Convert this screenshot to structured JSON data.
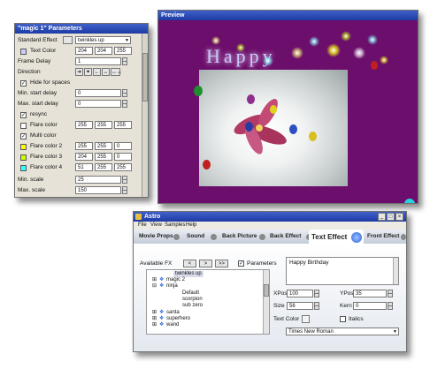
{
  "params": {
    "title": "\"magic 1\" Parameters",
    "standard_effect_label": "Standard Effect",
    "standard_effect_value": "twinkles up",
    "text_color_label": "Text Color",
    "text_color": [
      "204",
      "204",
      "255"
    ],
    "frame_delay_label": "Frame Delay",
    "frame_delay": "1",
    "direction_label": "Direction",
    "direction_buttons": [
      "➜",
      "✦",
      "←",
      "↔",
      "↔↔"
    ],
    "hide_spaces_label": "Hide for spaces",
    "min_start_delay_label": "Min. start delay",
    "min_start_delay": "0",
    "max_start_delay_label": "Max. start delay",
    "max_start_delay": "0",
    "resync_label": "resync",
    "flare_color_label": "Flare color",
    "flare_color": [
      "255",
      "255",
      "255"
    ],
    "multi_color_label": "Multi color",
    "flare_color_2_label": "Flare color 2",
    "flare_color_2": [
      "255",
      "255",
      "0"
    ],
    "flare_color_3_label": "Flare color 3",
    "flare_color_3": [
      "204",
      "255",
      "0"
    ],
    "flare_color_4_label": "Flare color 4",
    "flare_color_4": [
      "51",
      "255",
      "255"
    ],
    "min_scale_label": "Min. scale",
    "min_scale": "25",
    "max_scale_label": "Max. scale",
    "max_scale": "150"
  },
  "preview": {
    "title": "Preview",
    "text": "Happy"
  },
  "astro": {
    "title": "Astro",
    "menu": [
      "File",
      "View",
      "Samples",
      "Help"
    ],
    "tabs": [
      "Movie Props",
      "Sound",
      "Back Picture",
      "Back Effect",
      "Text Effect",
      "Front Effect"
    ],
    "available_fx_label": "Available FX",
    "nav_buttons": [
      "<",
      ">",
      ">>"
    ],
    "parameters_label": "Parameters",
    "tree_items": [
      "twinkles up",
      "magic 2",
      "ninja",
      "Default",
      "scorpion",
      "sub zero",
      "santa",
      "superhero",
      "wand"
    ],
    "text_value": "Happy Birthday",
    "xpos_label": "XPos",
    "xpos": "100",
    "ypos_label": "YPos",
    "ypos": "35",
    "size_label": "Size",
    "size": "56",
    "kern_label": "Kern",
    "kern": "0",
    "text_color_label": "Text Color",
    "italics_label": "Italics",
    "font": "Times New Roman"
  },
  "colors": {
    "preview_bg": "#6c0f6c",
    "titlebar": "#1d3aa3",
    "accent_blue": "#2a62d8"
  }
}
